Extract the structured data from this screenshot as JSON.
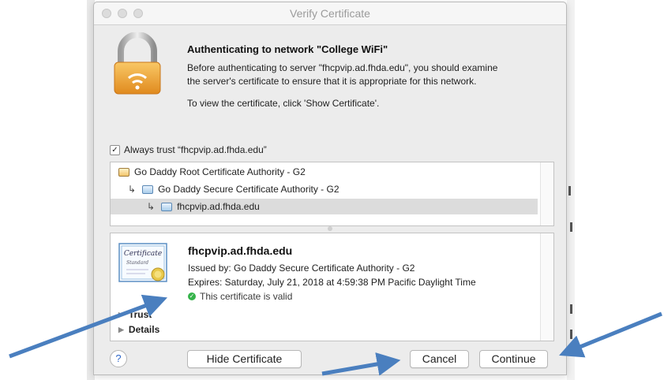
{
  "window": {
    "title": "Verify Certificate"
  },
  "message": {
    "heading": "Authenticating to network \"College WiFi\"",
    "line1": "Before authenticating to server \"fhcpvip.ad.fhda.edu\", you should examine",
    "line2": "the server's certificate to ensure that it is appropriate for this network.",
    "line3": "To view the certificate, click 'Show Certificate'."
  },
  "always_trust": {
    "checked_glyph": "✓",
    "label": "Always trust “fhcpvip.ad.fhda.edu”"
  },
  "chain": {
    "root": "Go Daddy Root Certificate Authority - G2",
    "intermediate": "Go Daddy Secure Certificate Authority - G2",
    "leaf": "fhcpvip.ad.fhda.edu",
    "arrow_glyph": "↳"
  },
  "detail": {
    "name": "fhcpvip.ad.fhda.edu",
    "issued_by": "Issued by: Go Daddy Secure Certificate Authority - G2",
    "expires": "Expires: Saturday, July 21, 2018 at 4:59:38 PM Pacific Daylight Time",
    "valid_text": "This certificate is valid",
    "trust_label": "Trust",
    "details_label": "Details",
    "badge_word1": "Certificate",
    "badge_word2": "Standard"
  },
  "buttons": {
    "help": "?",
    "hide_certificate": "Hide Certificate",
    "cancel": "Cancel",
    "continue": "Continue"
  },
  "colors": {
    "annotation_arrow": "#4a7fbf",
    "valid_green": "#35b34a"
  }
}
